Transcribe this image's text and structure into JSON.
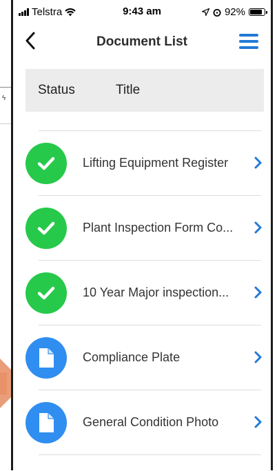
{
  "status_bar": {
    "carrier": "Telstra",
    "time": "9:43 am",
    "battery": "92%",
    "battery_level": 0.92
  },
  "nav": {
    "title": "Document List",
    "back_icon": "chevron-left-icon",
    "menu_icon": "hamburger-menu-icon"
  },
  "table_header": {
    "status": "Status",
    "title": "Title"
  },
  "colors": {
    "accent": "#2279d6",
    "complete": "#27c94a",
    "document": "#2f8ef0"
  },
  "documents": [
    {
      "title": "Lifting Equipment Register",
      "status": "complete",
      "icon": "checkmark-icon"
    },
    {
      "title": "Plant Inspection Form Co...",
      "status": "complete",
      "icon": "checkmark-icon"
    },
    {
      "title": "10 Year Major inspection...",
      "status": "complete",
      "icon": "checkmark-icon"
    },
    {
      "title": "Compliance Plate",
      "status": "pending",
      "icon": "document-icon"
    },
    {
      "title": "General Condition Photo",
      "status": "pending",
      "icon": "document-icon"
    }
  ]
}
